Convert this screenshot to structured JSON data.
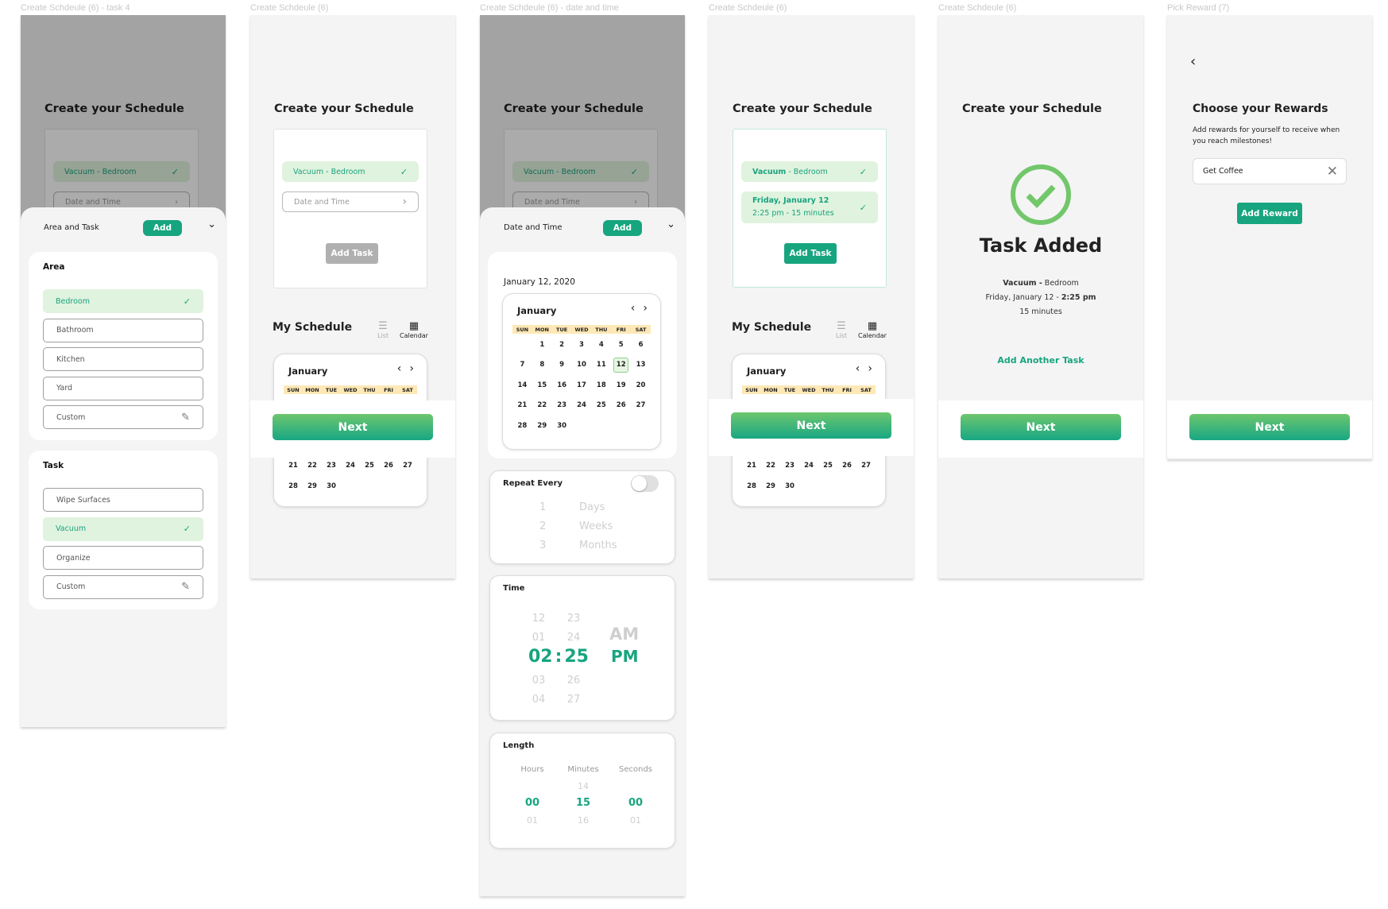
{
  "frames": {
    "f1": {
      "label": "Create Schdeule (6) - task 4"
    },
    "f2": {
      "label": "Create Schdeule (6)"
    },
    "f3": {
      "label": "Create Schdeule (6) - date and time"
    },
    "f4": {
      "label": "Create Schdeule (6)"
    },
    "f5": {
      "label": "Create Schdeule (6)"
    },
    "f6": {
      "label": "Pick Reward (7)"
    }
  },
  "common": {
    "title": "Create your Schedule",
    "task_summary": "Vacuum - Bedroom",
    "date_time_placeholder": "Date and Time",
    "add_task": "Add Task",
    "next": "Next",
    "my_schedule": "My Schedule",
    "list_label": "List",
    "calendar_label": "Calendar",
    "add": "Add"
  },
  "calendar": {
    "month": "January",
    "weekdays": [
      "SUN",
      "MON",
      "TUE",
      "WED",
      "THU",
      "FRI",
      "SAT"
    ],
    "days": [
      "",
      "1",
      "2",
      "3",
      "4",
      "5",
      "6",
      "7",
      "8",
      "9",
      "10",
      "11",
      "12",
      "13",
      "14",
      "15",
      "16",
      "17",
      "18",
      "19",
      "20",
      "21",
      "22",
      "23",
      "24",
      "25",
      "26",
      "27",
      "28",
      "29",
      "30"
    ],
    "selected_day": "12"
  },
  "area_task_sheet": {
    "header": "Area and Task",
    "area_title": "Area",
    "areas": [
      {
        "label": "Bedroom",
        "selected": true
      },
      {
        "label": "Bathroom",
        "selected": false
      },
      {
        "label": "Kitchen",
        "selected": false
      },
      {
        "label": "Yard",
        "selected": false
      },
      {
        "label": "Custom",
        "selected": false,
        "editable": true
      }
    ],
    "task_title": "Task",
    "tasks": [
      {
        "label": "Wipe Surfaces",
        "selected": false
      },
      {
        "label": "Vacuum",
        "selected": true
      },
      {
        "label": "Organize",
        "selected": false
      },
      {
        "label": "Custom",
        "selected": false,
        "editable": true
      }
    ]
  },
  "date_time_sheet": {
    "header": "Date and Time",
    "selected_date": "January 12, 2020",
    "repeat": {
      "title": "Repeat Every",
      "enabled": false,
      "numbers": [
        "1",
        "2",
        "3"
      ],
      "units": [
        "Days",
        "Weeks",
        "Months"
      ]
    },
    "time": {
      "title": "Time",
      "hours_above": [
        "12",
        "01"
      ],
      "hour": "02",
      "hours_below": [
        "03",
        "04"
      ],
      "minutes_above": [
        "23",
        "24"
      ],
      "minute": "25",
      "minutes_below": [
        "26",
        "27"
      ],
      "separator": ":",
      "am": "AM",
      "pm": "PM",
      "meridiem_selected": "PM"
    },
    "length": {
      "title": "Length",
      "columns": [
        {
          "label": "Hours",
          "above": "",
          "value": "00",
          "below": "01"
        },
        {
          "label": "Minutes",
          "above": "14",
          "value": "15",
          "below": "16"
        },
        {
          "label": "Seconds",
          "above": "",
          "value": "00",
          "below": "01"
        }
      ]
    }
  },
  "filled_card": {
    "task_bold": "Vacuum",
    "task_rest": " - Bedroom",
    "date_line": "Friday, January 12",
    "time_line": "2:25 pm  -  15 minutes"
  },
  "task_added": {
    "heading": "Task Added",
    "task_bold": "Vacuum -",
    "task_rest": " Bedroom",
    "date_text": "Friday, January 12 - ",
    "time_bold": "2:25 pm",
    "duration": "15 minutes",
    "add_another": "Add Another Task"
  },
  "rewards": {
    "title": "Choose your Rewards",
    "subtitle": "Add rewards for yourself to receive when you reach milestones!",
    "input_value": "Get Coffee",
    "add_reward": "Add Reward"
  },
  "colors": {
    "accent": "#17a57f",
    "selected_bg": "#e0f3de",
    "success": "#72c76a",
    "weekday_band": "#fde8b6"
  }
}
